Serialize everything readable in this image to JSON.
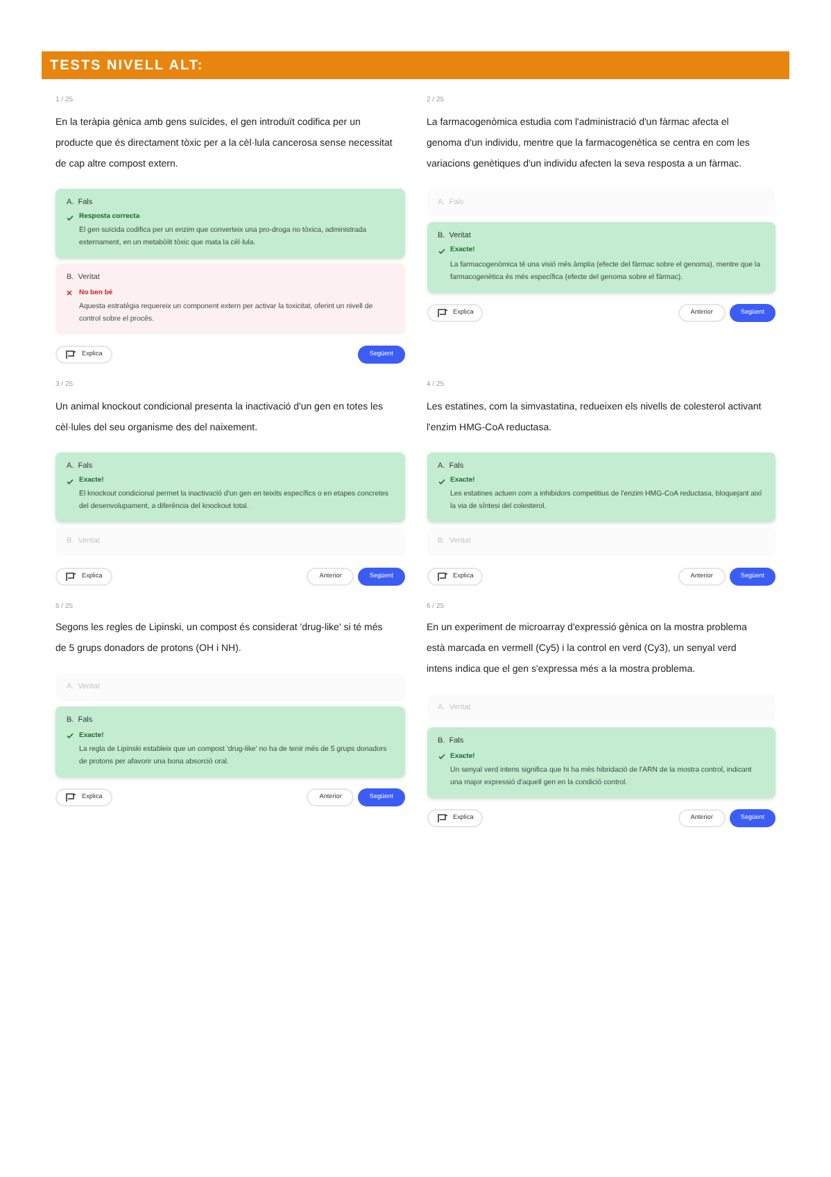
{
  "header": {
    "title": "TESTS NIVELL ALT:"
  },
  "questions": [
    {
      "counter": "1 / 25",
      "text": "En la teràpia gènica amb gens suïcides, el gen introduït codifica per un producte que és directament tòxic per a la cèl·lula cancerosa sense necessitat de cap altre compost extern.",
      "options": [
        {
          "label": "A.  Fals",
          "kind": "correct",
          "feedback_title": "Resposta correcta",
          "feedback": "El gen suïcida codifica per un enzim que converteix una pro-droga no tòxica, administrada externament, en un metabòlit tòxic que mata la cèl·lula."
        },
        {
          "label": "B.  Veritat",
          "kind": "wrong",
          "feedback_title": "No ben bé",
          "feedback": "Aquesta estratègia requereix un component extern per activar la toxicitat, oferint un nivell de control sobre el procés."
        }
      ],
      "buttons": {
        "explain": "Explica",
        "next": "Següent"
      }
    },
    {
      "counter": "2 / 25",
      "text": "La farmacogenòmica estudia com l'administració d'un fàrmac afecta el genoma d'un individu, mentre que la farmacogenètica se centra en com les variacions genètiques d'un individu afecten la seva resposta a un fàrmac.",
      "options": [
        {
          "label": "A.  Fals",
          "kind": "plain"
        },
        {
          "label": "B.  Veritat",
          "kind": "correct",
          "feedback_title": "Exacte!",
          "feedback": "La farmacogenòmica té una visió més àmplia (efecte del fàrmac sobre el genoma), mentre que la farmacogenètica és més específica (efecte del genoma sobre el fàrmac)."
        }
      ],
      "buttons": {
        "explain": "Explica",
        "previous": "Anterior",
        "next": "Següent"
      }
    },
    {
      "counter": "3 / 25",
      "text": "Un animal knockout condicional presenta la inactivació d'un gen en totes les cèl·lules del seu organisme des del naixement.",
      "options": [
        {
          "label": "A.  Fals",
          "kind": "correct",
          "feedback_title": "Exacte!",
          "feedback": "El knockout condicional permet la inactivació d'un gen en teixits específics o en etapes concretes del desenvolupament, a diferència del knockout total."
        },
        {
          "label": "B.  Veritat",
          "kind": "plain"
        }
      ],
      "buttons": {
        "explain": "Explica",
        "previous": "Anterior",
        "next": "Següent"
      }
    },
    {
      "counter": "4 / 25",
      "text": "Les estatines, com la simvastatina, redueixen els nivells de colesterol activant l'enzim HMG-CoA reductasa.",
      "options": [
        {
          "label": "A.  Fals",
          "kind": "correct",
          "feedback_title": "Exacte!",
          "feedback": "Les estatines actuen com a inhibidors competitius de l'enzim HMG-CoA reductasa, bloquejant així la via de síntesi del colesterol."
        },
        {
          "label": "B.  Veritat",
          "kind": "plain"
        }
      ],
      "buttons": {
        "explain": "Explica",
        "previous": "Anterior",
        "next": "Següent"
      }
    },
    {
      "counter": "5 / 25",
      "text": "Segons les regles de Lipinski, un compost és considerat 'drug-like' si té més de 5 grups donadors de protons (OH i NH).",
      "options": [
        {
          "label": "A.  Veritat",
          "kind": "plain"
        },
        {
          "label": "B.  Fals",
          "kind": "correct",
          "feedback_title": "Exacte!",
          "feedback": "La regla de Lipinski estableix que un compost 'drug-like' no ha de tenir més de 5 grups donadors de protons per afavorir una bona absorció oral."
        }
      ],
      "buttons": {
        "explain": "Explica",
        "previous": "Anterior",
        "next": "Següent"
      }
    },
    {
      "counter": "6 / 25",
      "text": "En un experiment de microarray d'expressió gènica on la mostra problema està marcada en vermell (Cy5) i la control en verd (Cy3), un senyal verd intens indica que el gen s'expressa més a la mostra problema.",
      "options": [
        {
          "label": "A.  Veritat",
          "kind": "plain"
        },
        {
          "label": "B.  Fals",
          "kind": "correct",
          "feedback_title": "Exacte!",
          "feedback": "Un senyal verd intens significa que hi ha més hibridació de l'ARN de la mostra control, indicant una major expressió d'aquell gen en la condició control."
        }
      ],
      "buttons": {
        "explain": "Explica",
        "previous": "Anterior",
        "next": "Següent"
      }
    }
  ]
}
